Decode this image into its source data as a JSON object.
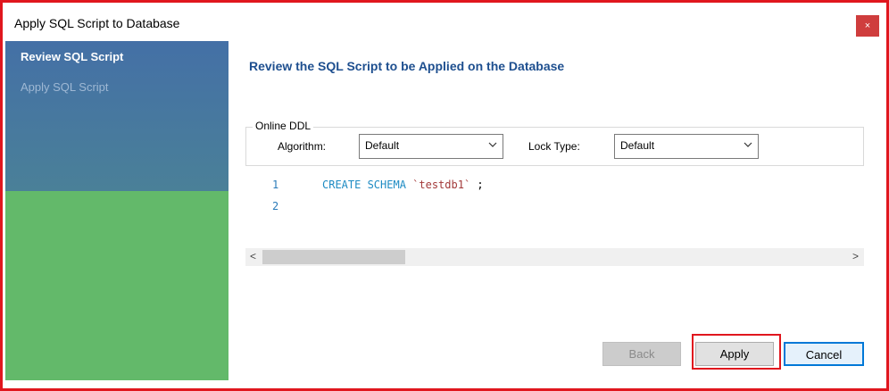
{
  "window": {
    "title": "Apply SQL Script to Database",
    "close_glyph": "×"
  },
  "sidebar": {
    "items": [
      {
        "label": "Review SQL Script",
        "state": "active"
      },
      {
        "label": "Apply SQL Script",
        "state": "inactive"
      }
    ]
  },
  "main": {
    "heading": "Review the SQL Script to be Applied on the Database",
    "online_ddl": {
      "legend": "Online DDL",
      "algorithm_label": "Algorithm:",
      "algorithm_value": "Default",
      "lock_type_label": "Lock Type:",
      "lock_type_value": "Default"
    },
    "editor": {
      "lines": [
        {
          "number": "1",
          "keyword": "CREATE SCHEMA",
          "identifier": "`testdb1`",
          "terminator": ";"
        },
        {
          "number": "2",
          "keyword": "",
          "identifier": "",
          "terminator": ""
        }
      ]
    },
    "scrollbar": {
      "left_arrow": "<",
      "right_arrow": ">"
    }
  },
  "buttons": {
    "back": "Back",
    "apply": "Apply",
    "cancel": "Cancel"
  },
  "colors": {
    "highlight": "#e0161e",
    "sidebar_blue": "#4470a6",
    "sidebar_green": "#63b96a",
    "heading": "#1e4f8f",
    "focus_border": "#0078d7"
  }
}
